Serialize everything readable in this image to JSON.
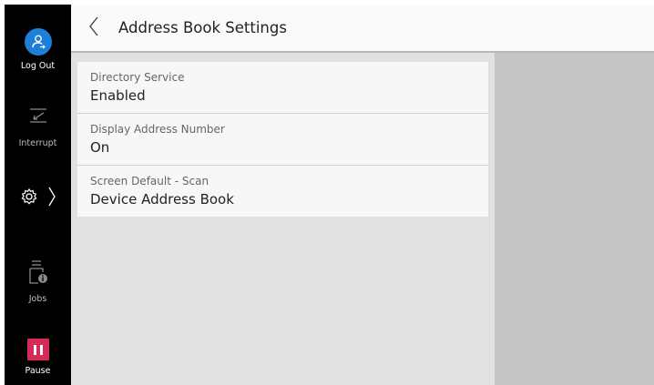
{
  "sidebar": {
    "logout_label": "Log Out",
    "interrupt_label": "Interrupt",
    "jobs_label": "Jobs",
    "pause_label": "Pause"
  },
  "header": {
    "title": "Address Book Settings"
  },
  "settings": [
    {
      "label": "Directory Service",
      "value": "Enabled"
    },
    {
      "label": "Display Address Number",
      "value": "On"
    },
    {
      "label": "Screen Default - Scan",
      "value": "Device Address Book"
    }
  ],
  "colors": {
    "logout_accent": "#1e7fd8",
    "pause_accent": "#d62a58",
    "sidebar_bg": "#000000"
  },
  "icons": [
    "user-logout-icon",
    "interrupt-icon",
    "gear-icon",
    "chevron-right-icon",
    "jobs-printer-info-icon",
    "pause-icon",
    "back-chevron-icon"
  ]
}
